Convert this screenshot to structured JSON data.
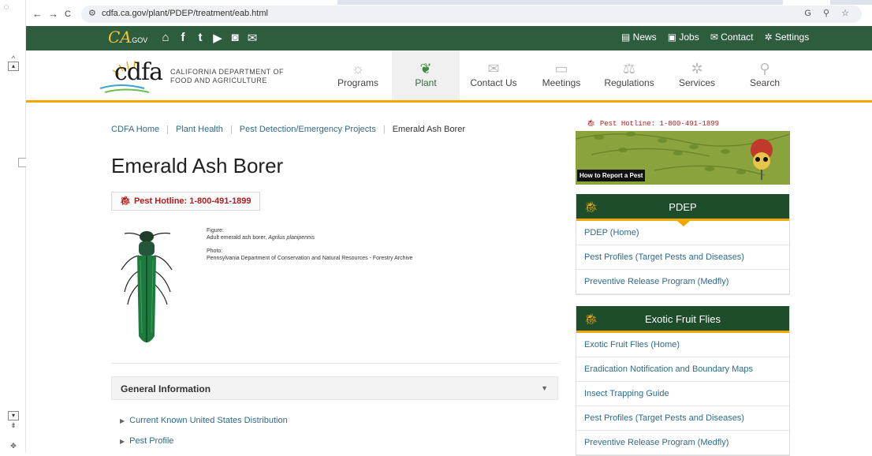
{
  "browser": {
    "url": "cdfa.ca.gov/plant/PDEP/treatment/eab.html",
    "back": "←",
    "forward": "→",
    "reload": "C"
  },
  "topbar": {
    "logo": "CA",
    "logo_suffix": ".GOV",
    "social": [
      "⌂",
      "f",
      "t",
      "▶",
      "◙",
      "✉"
    ],
    "util": [
      "News",
      "Jobs",
      "Contact",
      "Settings"
    ]
  },
  "header": {
    "brand": "cdfa",
    "dept_line1": "CALIFORNIA DEPARTMENT OF",
    "dept_line2": "FOOD AND AGRICULTURE",
    "menu": [
      {
        "label": "Programs",
        "icon": "sun-icon",
        "glyph": "☼",
        "active": false
      },
      {
        "label": "Plant",
        "icon": "leaf-icon",
        "glyph": "❦",
        "active": true
      },
      {
        "label": "Contact Us",
        "icon": "envelope-icon",
        "glyph": "✉",
        "active": false
      },
      {
        "label": "Meetings",
        "icon": "calendar-icon",
        "glyph": "▭",
        "active": false
      },
      {
        "label": "Regulations",
        "icon": "scales-icon",
        "glyph": "⚖",
        "active": false
      },
      {
        "label": "Services",
        "icon": "gear-icon",
        "glyph": "✲",
        "active": false
      },
      {
        "label": "Search",
        "icon": "search-icon",
        "glyph": "⚲",
        "active": false
      }
    ]
  },
  "breadcrumb": [
    "CDFA Home",
    "Plant Health",
    "Pest Detection/Emergency Projects",
    "Emerald Ash Borer"
  ],
  "page": {
    "title": "Emerald Ash Borer",
    "hotline": "Pest Hotline: 1-800-491-1899",
    "figure_label": "Figure:",
    "figure_caption_prefix": "Adult emerald ash borer, ",
    "figure_caption_species": "Agrilus planipennis",
    "photo_label": "Photo:",
    "photo_credit": "Pennsylvania Department of Conservation and Natural Resources - Forestry Archive",
    "accordion_title": "General Information",
    "links": [
      "Current Known United States Distribution",
      "Pest Profile"
    ]
  },
  "sidebar": {
    "hotline": "Pest Hotline: 1-800-491-1899",
    "banner_label": "How to Report a Pest",
    "panels": [
      {
        "title": "PDEP",
        "items": [
          "PDEP (Home)",
          "Pest Profiles (Target Pests and Diseases)",
          "Preventive Release Program (Medfly)"
        ]
      },
      {
        "title": "Exotic Fruit Flies",
        "items": [
          "Exotic Fruit Flies (Home)",
          "Eradication Notification and Boundary Maps",
          "Insect Trapping Guide",
          "Pest Profiles (Target Pests and Diseases)",
          "Preventive Release Program (Medfly)"
        ]
      }
    ]
  },
  "colors": {
    "topbar": "#2e5d3e",
    "panel_head": "#1e4d2b",
    "accent": "#f2a600",
    "link": "#2e6b8a",
    "hotline": "#b01c1c"
  }
}
